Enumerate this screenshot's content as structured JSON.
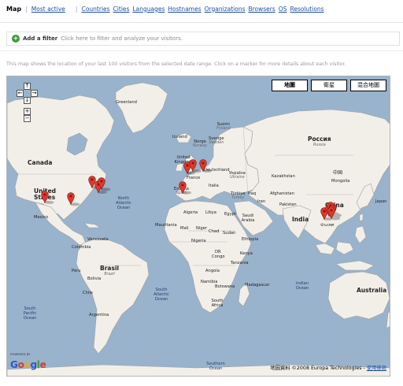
{
  "nav": {
    "current": "Map",
    "links": [
      "Most active",
      "Countries",
      "Cities",
      "Languages",
      "Hostnames",
      "Organizations",
      "Browsers",
      "OS",
      "Resolutions"
    ]
  },
  "filter": {
    "label": "Add a filter",
    "hint": "Click here to filter and analyze your visitors."
  },
  "description": "This map shows the location of your last 100 visitors from the selected date range. Click on a marker for more details about each visitor.",
  "map": {
    "map_types": [
      "地圖",
      "衛星",
      "混合地圖"
    ],
    "active_type": "地圖",
    "controls": {
      "pan_up": "↑",
      "pan_left": "←",
      "pan_right": "→",
      "pan_down": "↓",
      "zoom_in": "+",
      "zoom_out": "−"
    },
    "logo": {
      "powered": "POWERED BY",
      "word": "Google"
    },
    "attribution": {
      "text": "地圖資料 ©2008 Europa Technologies - ",
      "link": "使用條款"
    },
    "labels": {
      "greenland": "Greenland",
      "iceland": "Iceland",
      "canada": "Canada",
      "united_states": "United States",
      "mexico": "Mexico",
      "venezuela": "Venezuela",
      "colombia": "Colombia",
      "peru": "Peru",
      "brasil": "Brasil",
      "brazil_sub": "Brazil",
      "bolivia": "Bolivia",
      "chile": "Chile",
      "argentina": "Argentina",
      "north_atlantic": "North Atlantic Ocean",
      "south_atlantic": "South Atlantic Ocean",
      "south_pacific": "South Pacific Ocean",
      "southern_ocean": "Southern Ocean",
      "indian_ocean": "Indian Ocean",
      "suomi": "Suomi",
      "finland_sub": "Finland",
      "sverige": "Sverige",
      "sweden_sub": "Sweden",
      "norge": "Norge",
      "norway_sub": "Norway",
      "uk": "United Kingdom",
      "deutschland": "Deutschland",
      "france": "France",
      "espana": "España",
      "spain_sub": "Spain",
      "italia": "Italia",
      "ukraine": "Україна",
      "ukraine_sub": "Ukraine",
      "turkey": "Türkiye",
      "turkey_sub": "Turkey",
      "russia": "Россия",
      "russia_sub": "Russia",
      "kazakhstan": "Kazakhstan",
      "mongolia": "Mongolia",
      "china_zh": "中国",
      "china": "China",
      "afghanistan": "Afghanistan",
      "iran": "Iran",
      "iraq": "Iraq",
      "pakistan": "Pakistan",
      "india": "India",
      "myanmar": "ประเทศ",
      "japan": "Japan",
      "algeria": "Algeria",
      "libya": "Libya",
      "egypt": "Egypt",
      "saudi": "Saudi Arabia",
      "mauritania": "Mauritania",
      "mali": "Mali",
      "niger": "Niger",
      "chad": "Chad",
      "sudan": "Sudan",
      "ethiopia": "Ethiopia",
      "nigeria": "Nigeria",
      "kenya": "Kenya",
      "dr": "DR",
      "congo": "Congo",
      "tanzania": "Tanzania",
      "angola": "Angola",
      "namibia": "Namibia",
      "botswana": "Botswana",
      "madagascar": "Madagascar",
      "south_africa": "South Africa",
      "australia": "Australia"
    },
    "markers": [
      {
        "name": "marker-los-angeles",
        "lon": -118.2,
        "lat": 34.1
      },
      {
        "name": "marker-dallas",
        "lon": -96.8,
        "lat": 32.8
      },
      {
        "name": "marker-new-york",
        "lon": -74.0,
        "lat": 40.7
      },
      {
        "name": "marker-toronto",
        "lon": -79.4,
        "lat": 43.7
      },
      {
        "name": "marker-boston",
        "lon": -71.1,
        "lat": 42.4
      },
      {
        "name": "marker-madrid",
        "lon": -3.7,
        "lat": 40.4
      },
      {
        "name": "marker-london",
        "lon": -0.1,
        "lat": 51.5
      },
      {
        "name": "marker-amsterdam",
        "lon": 4.9,
        "lat": 52.4
      },
      {
        "name": "marker-berlin",
        "lon": 13.4,
        "lat": 52.5
      },
      {
        "name": "marker-hong-kong",
        "lon": 114.2,
        "lat": 22.3
      },
      {
        "name": "marker-taipei",
        "lon": 121.5,
        "lat": 25.0
      },
      {
        "name": "marker-xiamen",
        "lon": 118.1,
        "lat": 24.5
      },
      {
        "name": "marker-fuzhou",
        "lon": 119.3,
        "lat": 26.1
      },
      {
        "name": "marker-taichung",
        "lon": 120.7,
        "lat": 24.2
      },
      {
        "name": "marker-kaohsiung",
        "lon": 120.3,
        "lat": 22.6
      }
    ],
    "colors": {
      "water": "#99b3cc",
      "land": "#f2efe9",
      "marker": "#e0382c"
    }
  }
}
